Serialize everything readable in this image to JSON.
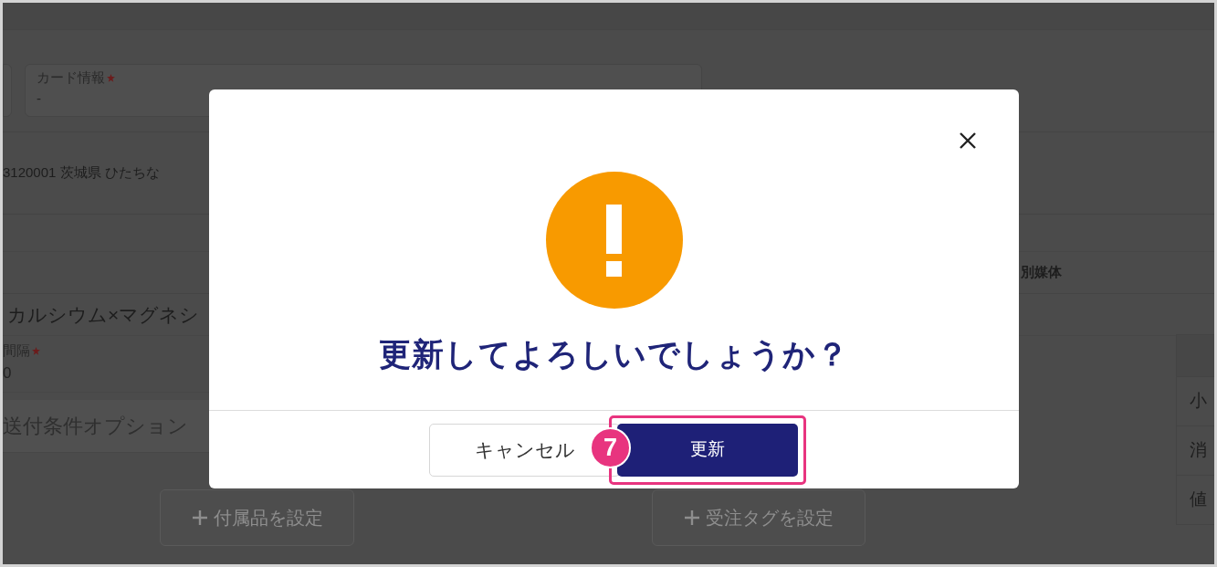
{
  "background": {
    "card_field": {
      "label": "カード情報",
      "required": true,
      "value": "-"
    },
    "address": "3120001 茨城県 ひたちな",
    "column_header": "別媒体",
    "product": "カルシウム×マグネシ",
    "interval_field": {
      "label": "間隔",
      "required": true,
      "value": "0"
    },
    "options_field": {
      "placeholder": "送付条件オプション"
    },
    "add_buttons": [
      {
        "label": "付属品を設定"
      },
      {
        "label": "受注タグを設定"
      }
    ],
    "summary_rows": [
      "小",
      "消",
      "値"
    ]
  },
  "dialog": {
    "title": "更新してよろしいでしょうか？",
    "buttons": [
      {
        "label": "キャンセル",
        "kind": "secondary",
        "highlighted": false
      },
      {
        "label": "更新",
        "kind": "primary",
        "highlighted": true
      }
    ],
    "step_badge": "7"
  }
}
